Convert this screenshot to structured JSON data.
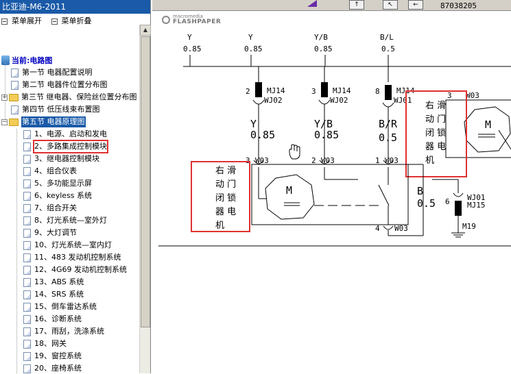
{
  "app": {
    "title": "比亚迪-M6-2011"
  },
  "menu_controls": {
    "expand": "菜单展开",
    "collapse": "菜单折叠"
  },
  "tree": {
    "root": "当前:电路图",
    "sections": [
      {
        "label": "第一节 电器配置说明",
        "type": "doc"
      },
      {
        "label": "第二节 电器件位置分布图",
        "type": "doc"
      },
      {
        "label": "第三节 继电器、保险丝位置分布图",
        "type": "folder"
      },
      {
        "label": "第四节 低压线束布置图",
        "type": "doc"
      },
      {
        "label": "第五节 电器原理图",
        "type": "folder",
        "selected": true
      }
    ],
    "items": [
      "1、电源、启动和发电",
      "2、多路集成控制模块",
      "3、继电器控制模块",
      "4、组合仪表",
      "5、多功能显示屏",
      "6、keyless 系统",
      "7、组合开关",
      "8、灯光系统—室外灯",
      "9、大灯调节",
      "10、灯光系统—室内灯",
      "11、483 发动机控制系统",
      "12、4G69 发动机控制系统",
      "13、ABS 系统",
      "14、SRS 系统",
      "15、倒车雷达系统",
      "16、诊断系统",
      "17、雨刮，洗涤系统",
      "18、网关",
      "19、窗控系统",
      "20、座椅系统"
    ],
    "highlighted_item": 1
  },
  "viewer": {
    "phone": "87038205",
    "logo_top": "macromedia",
    "logo_bottom": "FLASHPAPER"
  },
  "diagram": {
    "top_wires": [
      {
        "color": "Y",
        "size": "0.85"
      },
      {
        "color": "Y",
        "size": "0.85"
      },
      {
        "color": "Y/B",
        "size": "0.85"
      },
      {
        "color": "B/L",
        "size": "0.5"
      }
    ],
    "connectors": [
      {
        "pin": "2",
        "code": "MJ14",
        "sub": "WJ02"
      },
      {
        "pin": "3",
        "code": "MJ14",
        "sub": "WJ02"
      },
      {
        "pin": "8",
        "code": "MJ14",
        "sub": "WJ01"
      }
    ],
    "mid_wires": [
      {
        "color": "Y",
        "size": "0.85"
      },
      {
        "color": "Y/B",
        "size": "0.85"
      },
      {
        "color": "B/R",
        "size": "0.5"
      }
    ],
    "motor_right_label": "右滑动门闭锁器电机",
    "motor_left_label": "右滑动门闭锁器电机",
    "motor_symbol": "M",
    "w03_pins": [
      {
        "pin": "3",
        "code": "W03"
      },
      {
        "pin": "2",
        "code": "W03"
      },
      {
        "pin": "1",
        "code": "W03"
      },
      {
        "pin": "4",
        "code": "W03"
      },
      {
        "pin": "3",
        "code": "W03"
      }
    ],
    "ground_wire": {
      "color": "B",
      "size": "0.5"
    },
    "ground_conn": {
      "pin": "6",
      "code": "WJ01",
      "sub": "MJ15",
      "ground": "M19"
    }
  }
}
